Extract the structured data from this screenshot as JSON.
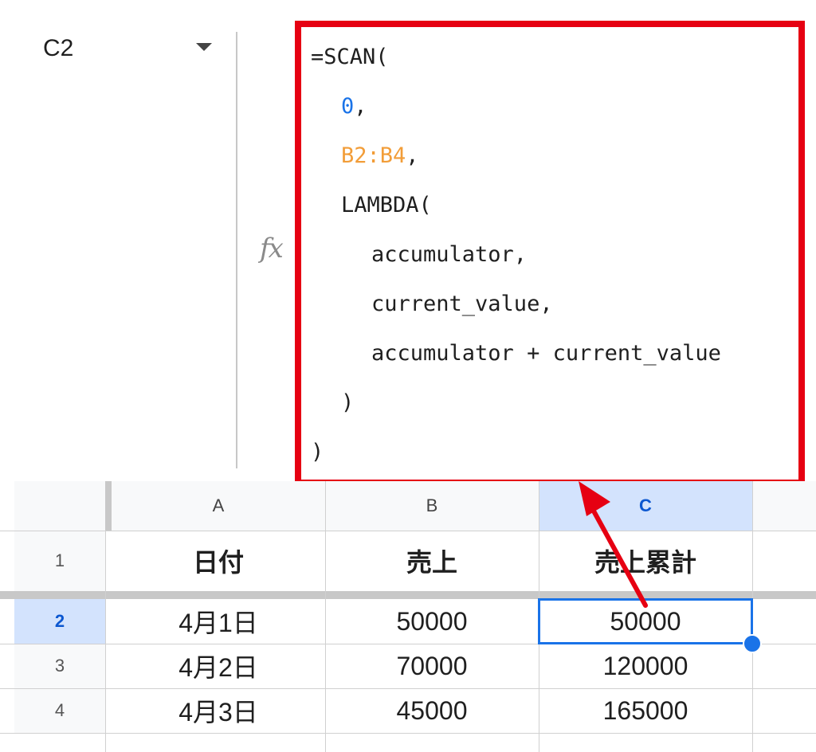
{
  "name_box": {
    "value": "C2"
  },
  "formula_bar": {
    "fx_label": "fx",
    "lines": [
      {
        "plain": "=SCAN("
      },
      {
        "num": "0",
        "after": ","
      },
      {
        "ref": "B2:B4",
        "after": ","
      },
      {
        "plain": "LAMBDA("
      },
      {
        "plain": "accumulator,"
      },
      {
        "plain": "current_value,"
      },
      {
        "plain": "accumulator + current_value"
      },
      {
        "plain": ")"
      },
      {
        "plain": ")"
      }
    ]
  },
  "sheet": {
    "columns": [
      "A",
      "B",
      "C"
    ],
    "selected_column": "C",
    "rows": [
      {
        "num": "1",
        "cells": [
          "日付",
          "売上",
          "売上累計"
        ],
        "bold": true
      },
      {
        "num": "2",
        "cells": [
          "4月1日",
          "50000",
          "50000"
        ],
        "selected": true
      },
      {
        "num": "3",
        "cells": [
          "4月2日",
          "70000",
          "120000"
        ]
      },
      {
        "num": "4",
        "cells": [
          "4月3日",
          "45000",
          "165000"
        ]
      }
    ]
  },
  "colors": {
    "highlight_box": "#e60012",
    "selection": "#1a73e8",
    "number_literal": "#1a73e8",
    "range_ref": "#f29d38"
  }
}
